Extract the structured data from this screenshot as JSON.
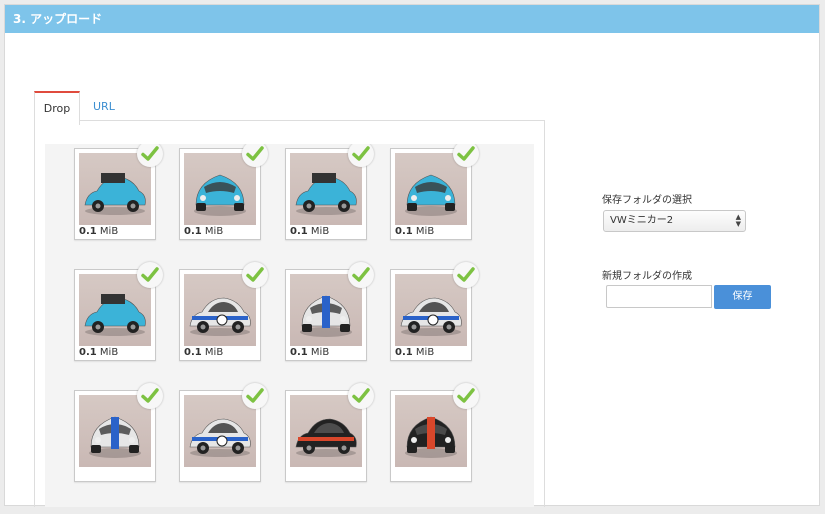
{
  "header": {
    "title": "3. アップロード"
  },
  "tabs": [
    {
      "label": "Drop",
      "active": true
    },
    {
      "label": "URL",
      "active": false
    }
  ],
  "files": [
    {
      "size_value": "0.1",
      "size_unit": "MiB",
      "color": "#3bb3d8",
      "view": "side-open"
    },
    {
      "size_value": "0.1",
      "size_unit": "MiB",
      "color": "#3bb3d8",
      "view": "front"
    },
    {
      "size_value": "0.1",
      "size_unit": "MiB",
      "color": "#3bb3d8",
      "view": "side-open"
    },
    {
      "size_value": "0.1",
      "size_unit": "MiB",
      "color": "#3bb3d8",
      "view": "rear"
    },
    {
      "size_value": "0.1",
      "size_unit": "MiB",
      "color": "#3bb3d8",
      "view": "side-open"
    },
    {
      "size_value": "0.1",
      "size_unit": "MiB",
      "color": "#e6e6e6",
      "view": "side"
    },
    {
      "size_value": "0.1",
      "size_unit": "MiB",
      "color": "#e6e6e6",
      "view": "front"
    },
    {
      "size_value": "0.1",
      "size_unit": "MiB",
      "color": "#e6e6e6",
      "view": "side"
    },
    {
      "size_value": "",
      "size_unit": "",
      "color": "#e6e6e6",
      "view": "rear"
    },
    {
      "size_value": "",
      "size_unit": "",
      "color": "#e6e6e6",
      "view": "side"
    },
    {
      "size_value": "",
      "size_unit": "",
      "color": "#222222",
      "view": "side"
    },
    {
      "size_value": "",
      "size_unit": "",
      "color": "#222222",
      "view": "front"
    }
  ],
  "folder_select": {
    "label": "保存フォルダの選択",
    "value": "VWミニカー2"
  },
  "new_folder": {
    "label": "新規フォルダの作成",
    "input_value": "",
    "save_label": "保存"
  },
  "colors": {
    "header_bg": "#7ec4ea",
    "accent_blue": "#4a90d9",
    "active_tab_border": "#e04b3d",
    "check_green": "#7dc242"
  }
}
